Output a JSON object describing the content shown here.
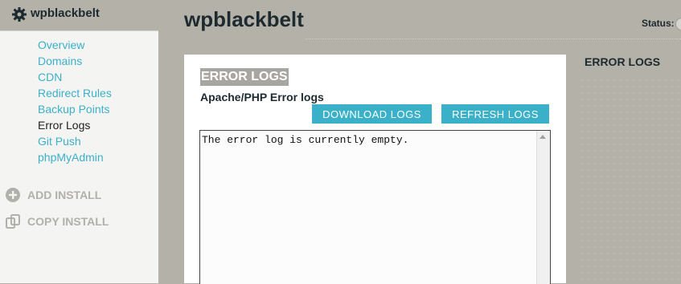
{
  "sidebar": {
    "site_name": "wpblackbelt",
    "nav": [
      {
        "label": "Overview"
      },
      {
        "label": "Domains"
      },
      {
        "label": "CDN"
      },
      {
        "label": "Redirect Rules"
      },
      {
        "label": "Backup Points"
      },
      {
        "label": "Error Logs",
        "active": true
      },
      {
        "label": "Git Push"
      },
      {
        "label": "phpMyAdmin"
      }
    ],
    "add_install_label": "ADD INSTALL",
    "copy_install_label": "COPY INSTALL",
    "icons": {
      "gear": "gear-icon",
      "add": "plus-circle-icon",
      "copy": "copy-icon"
    }
  },
  "header": {
    "title": "wpblackbelt",
    "status_label": "Status:"
  },
  "panel": {
    "heading": "ERROR LOGS",
    "subheading": "Apache/PHP Error logs",
    "download_label": "DOWNLOAD LOGS",
    "refresh_label": "REFRESH LOGS",
    "log_content": "The error log is currently empty."
  },
  "right_column": {
    "title": "ERROR LOGS"
  },
  "colors": {
    "accent": "#3bb0c9",
    "background": "#b3b1a8",
    "sidebar": "#f4f4f3",
    "heading_bg": "#a7a6a1"
  }
}
